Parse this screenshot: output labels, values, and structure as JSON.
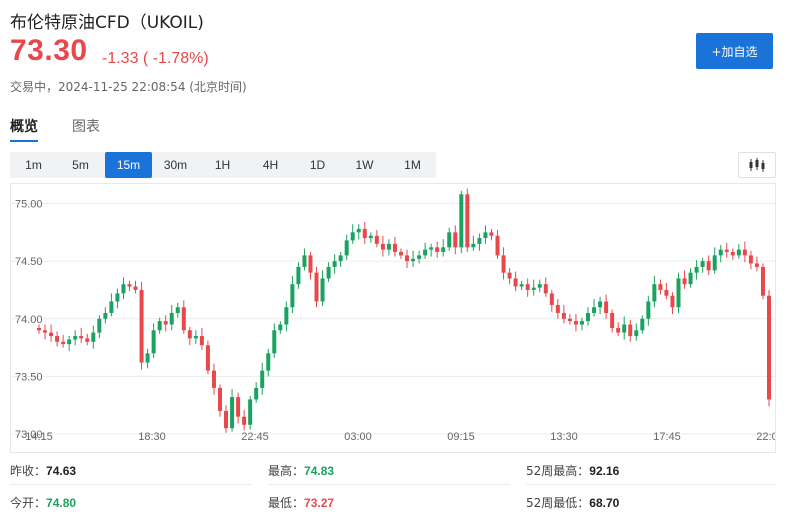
{
  "header": {
    "title": "布伦特原油CFD（UKOIL)",
    "price": "73.30",
    "change": "-1.33 ( -1.78%)",
    "status": "交易中，2024-11-25 22:08:54 (北京时间)",
    "add_button": "+加自选"
  },
  "tabs": [
    {
      "label": "概览",
      "active": true
    },
    {
      "label": "图表",
      "active": false
    }
  ],
  "intervals": [
    {
      "label": "1m",
      "active": false
    },
    {
      "label": "5m",
      "active": false
    },
    {
      "label": "15m",
      "active": true
    },
    {
      "label": "30m",
      "active": false
    },
    {
      "label": "1H",
      "active": false
    },
    {
      "label": "4H",
      "active": false
    },
    {
      "label": "1D",
      "active": false
    },
    {
      "label": "1W",
      "active": false
    },
    {
      "label": "1M",
      "active": false
    }
  ],
  "chart_type_icon": "candlestick-icon",
  "colors": {
    "up": "#1aa260",
    "down": "#e8484b",
    "accent": "#1a73d9"
  },
  "chart_data": {
    "type": "candlestick",
    "interval": "15m",
    "y_ticks": [
      "75.00",
      "74.50",
      "74.00",
      "73.50",
      "73.00"
    ],
    "x_ticks": [
      "14:15",
      "18:30",
      "22:45",
      "03:00",
      "09:15",
      "13:30",
      "17:45",
      "22:0"
    ],
    "ylim": [
      73.0,
      75.1
    ],
    "grid": true,
    "close": [
      73.9,
      73.88,
      73.85,
      73.8,
      73.78,
      73.82,
      73.85,
      73.83,
      73.8,
      73.88,
      74.0,
      74.05,
      74.15,
      74.22,
      74.3,
      74.28,
      74.25,
      73.62,
      73.7,
      73.9,
      73.98,
      73.95,
      74.05,
      74.1,
      73.9,
      73.83,
      73.85,
      73.77,
      73.55,
      73.4,
      73.2,
      73.05,
      73.32,
      73.15,
      73.08,
      73.3,
      73.4,
      73.55,
      73.7,
      73.9,
      73.95,
      74.1,
      74.3,
      74.45,
      74.55,
      74.4,
      74.15,
      74.35,
      74.45,
      74.5,
      74.55,
      74.68,
      74.75,
      74.78,
      74.7,
      74.72,
      74.65,
      74.6,
      74.65,
      74.58,
      74.55,
      74.5,
      74.52,
      74.55,
      74.6,
      74.62,
      74.58,
      74.62,
      74.75,
      74.62,
      74.6,
      74.62,
      74.65,
      74.7,
      74.75,
      74.72,
      74.55,
      74.4,
      74.35,
      74.28,
      74.3,
      74.25,
      74.27,
      74.3,
      74.22,
      74.12,
      74.05,
      74.0,
      73.98,
      73.95,
      73.98,
      74.05,
      74.1,
      74.15,
      74.05,
      73.92,
      73.88,
      73.95,
      73.85,
      73.9,
      74.0,
      74.15,
      74.3,
      74.25,
      74.2,
      74.1,
      74.35,
      74.3,
      74.4,
      74.45,
      74.5,
      74.42,
      74.55,
      74.6,
      74.58,
      74.55,
      74.6,
      74.55,
      74.48,
      74.45,
      74.2,
      73.3
    ],
    "open_max": 75.08,
    "low_min": 73.0
  },
  "stats": [
    {
      "label": "昨收：",
      "value": "74.63",
      "tone": "dark"
    },
    {
      "label": "最高：",
      "value": "74.83",
      "tone": "green"
    },
    {
      "label": "52周最高：",
      "value": "92.16",
      "tone": "dark"
    },
    {
      "label": "今开：",
      "value": "74.80",
      "tone": "green"
    },
    {
      "label": "最低：",
      "value": "73.27",
      "tone": "red"
    },
    {
      "label": "52周最低：",
      "value": "68.70",
      "tone": "dark"
    }
  ]
}
